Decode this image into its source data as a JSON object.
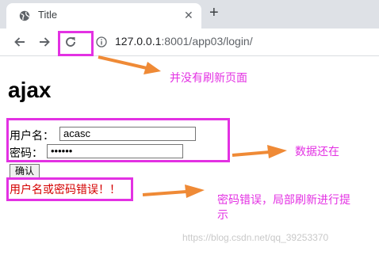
{
  "browser": {
    "tab_title": "Title",
    "close_glyph": "✕",
    "new_tab_glyph": "+",
    "url_host": "127.0.0.1",
    "url_rest": ":8001/app03/login/"
  },
  "page": {
    "heading": "ajax",
    "username_label": "用户名：",
    "username_value": "acasc",
    "password_label": "密码：",
    "password_value": "••••••",
    "submit_label": "确认",
    "error_message": "用户名或密码错误！！"
  },
  "annotations": {
    "refresh_note": "并没有刷新页面",
    "data_note": "数据还在",
    "error_note_line1": "密码错误，局部刷新进行提",
    "error_note_line2": "示",
    "color": "#e331e3",
    "arrow_color": "#ef8a36"
  },
  "watermark": "https://blog.csdn.net/qq_39253370",
  "icons": [
    "globe-icon",
    "back-arrow-icon",
    "forward-arrow-icon",
    "reload-icon",
    "info-icon",
    "close-icon",
    "new-tab-icon"
  ]
}
